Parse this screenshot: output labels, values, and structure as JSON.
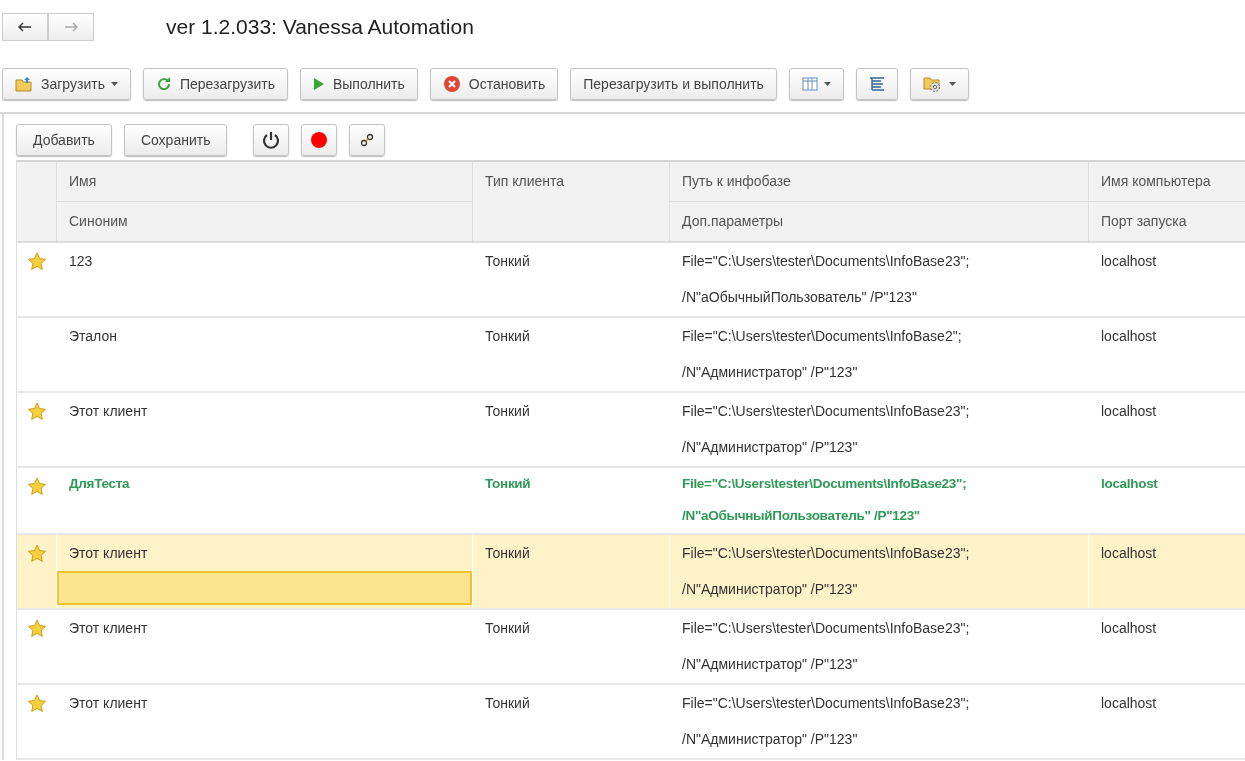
{
  "window": {
    "title": "ver 1.2.033: Vanessa Automation"
  },
  "toolbar": [
    {
      "kind": "load",
      "label": "Загрузить",
      "dropdown": true
    },
    {
      "kind": "reload",
      "label": "Перезагрузить",
      "dropdown": false
    },
    {
      "kind": "run",
      "label": "Выполнить",
      "dropdown": false
    },
    {
      "kind": "stop",
      "label": "Остановить",
      "dropdown": false
    },
    {
      "kind": "text",
      "label": "Перезагрузить и выполнить",
      "dropdown": false
    },
    {
      "kind": "columns",
      "dropdown": true
    },
    {
      "kind": "tree",
      "dropdown": false
    },
    {
      "kind": "settings",
      "dropdown": true
    }
  ],
  "form_toolbar": [
    {
      "kind": "text",
      "label": "Добавить"
    },
    {
      "kind": "text",
      "label": "Сохранить"
    },
    {
      "kind": "power"
    },
    {
      "kind": "record"
    },
    {
      "kind": "link"
    }
  ],
  "table": {
    "columns": [
      {
        "top": "Имя",
        "bottom": "Синоним"
      },
      {
        "top": "Тип клиента"
      },
      {
        "top": "Путь к инфобазе",
        "bottom": "Доп.параметры"
      },
      {
        "top": "Имя компьютера",
        "bottom": "Порт запуска"
      }
    ],
    "rows": [
      {
        "starred": true,
        "active": false,
        "selected": false,
        "name": "123",
        "type": "Тонкий",
        "path": "File=\"C:\\Users\\tester\\Documents\\InfoBase23\";",
        "params": "/N\"аОбычныйПользователь\" /P\"123\"",
        "host": "localhost"
      },
      {
        "starred": false,
        "active": false,
        "selected": false,
        "name": "Эталон",
        "type": "Тонкий",
        "path": "File=\"C:\\Users\\tester\\Documents\\InfoBase2\";",
        "params": "/N\"Администратор\" /P\"123\"",
        "host": "localhost"
      },
      {
        "starred": true,
        "active": false,
        "selected": false,
        "name": "Этот клиент",
        "type": "Тонкий",
        "path": "File=\"C:\\Users\\tester\\Documents\\InfoBase23\";",
        "params": "/N\"Администратор\" /P\"123\"",
        "host": "localhost"
      },
      {
        "starred": true,
        "active": true,
        "selected": false,
        "name": "ДляТеста",
        "type": "Тонкий",
        "path": "File=\"C:\\Users\\tester\\Documents\\InfoBase23\";",
        "params": "/N\"аОбычныйПользователь\" /P\"123\"",
        "host": "localhost"
      },
      {
        "starred": true,
        "active": false,
        "selected": true,
        "name": "Этот клиент",
        "type": "Тонкий",
        "path": "File=\"C:\\Users\\tester\\Documents\\InfoBase23\";",
        "params": "/N\"Администратор\" /P\"123\"",
        "host": "localhost"
      },
      {
        "starred": true,
        "active": false,
        "selected": false,
        "name": "Этот клиент",
        "type": "Тонкий",
        "path": "File=\"C:\\Users\\tester\\Documents\\InfoBase23\";",
        "params": "/N\"Администратор\" /P\"123\"",
        "host": "localhost"
      },
      {
        "starred": true,
        "active": false,
        "selected": false,
        "name": "Этот клиент",
        "type": "Тонкий",
        "path": "File=\"C:\\Users\\tester\\Documents\\InfoBase23\";",
        "params": "/N\"Администратор\" /P\"123\"",
        "host": "localhost"
      }
    ]
  }
}
